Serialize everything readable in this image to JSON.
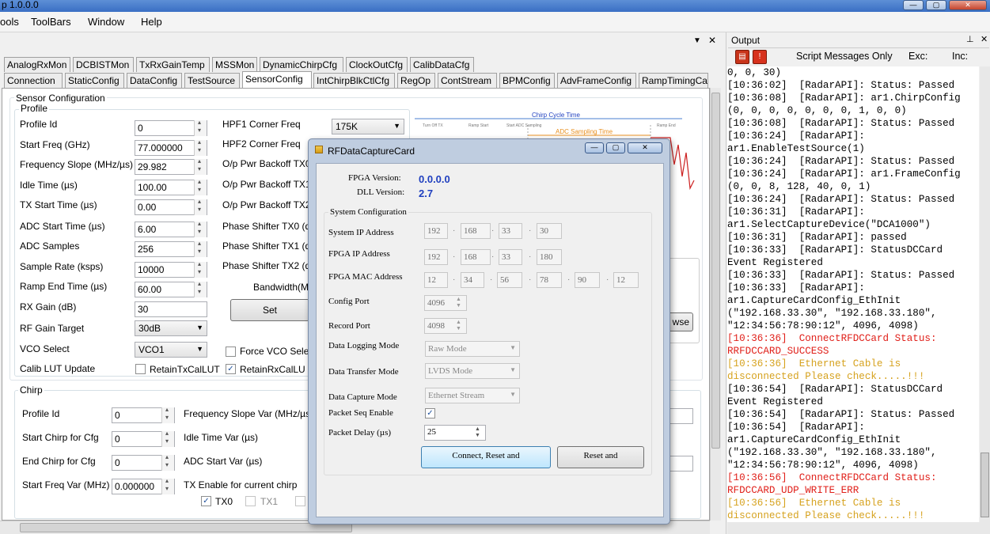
{
  "window": {
    "title": "p 1.0.0.0",
    "min": "—",
    "max": "▢",
    "close": "✕"
  },
  "menu": [
    "ools",
    "ToolBars",
    "Window",
    "Help"
  ],
  "tabs_row1": [
    "AnalogRxMon",
    "DCBISTMon",
    "TxRxGainTemp",
    "MSSMon",
    "DynamicChirpCfg",
    "ClockOutCfg",
    "CalibDataCfg"
  ],
  "tabs_row2": [
    "Connection",
    "StaticConfig",
    "DataConfig",
    "TestSource",
    "SensorConfig",
    "IntChirpBlkCtlCfg",
    "RegOp",
    "ContStream",
    "BPMConfig",
    "AdvFrameConfig",
    "RampTimingCa"
  ],
  "sensor": {
    "group": "Sensor Configuration",
    "profile_group": "Profile",
    "fields": [
      {
        "label": "Profile Id",
        "value": "0"
      },
      {
        "label": "Start Freq (GHz)",
        "value": "77.000000"
      },
      {
        "label": "Frequency Slope (MHz/µs)",
        "value": "29.982"
      },
      {
        "label": "Idle Time (µs)",
        "value": "100.00"
      },
      {
        "label": "TX Start Time (µs)",
        "value": "0.00"
      },
      {
        "label": "ADC Start Time (µs)",
        "value": "6.00"
      },
      {
        "label": "ADC Samples",
        "value": "256"
      },
      {
        "label": "Sample Rate (ksps)",
        "value": "10000"
      },
      {
        "label": "Ramp End Time (µs)",
        "value": "60.00"
      },
      {
        "label": "RX Gain (dB)",
        "value": "30"
      }
    ],
    "rf_gain_label": "RF Gain Target",
    "rf_gain_value": "30dB",
    "vco_label": "VCO Select",
    "vco_value": "VCO1",
    "calib_label": "Calib LUT Update",
    "retain_tx": "RetainTxCalLUT",
    "retain_rx": "RetainRxCalLU",
    "right_labels": [
      "HPF1 Corner Freq",
      "HPF2 Corner Freq",
      "O/p Pwr Backoff TX0",
      "O/p Pwr Backoff TX1",
      "O/p Pwr Backoff TX2",
      "Phase Shifter TX0 (d",
      "Phase Shifter TX1 (d",
      "Phase Shifter TX2 (d"
    ],
    "hpf1_value": "175K",
    "bandwidth_label": "Bandwidth(M",
    "set_button": "Set",
    "force_vco": "Force VCO Sele",
    "browse": "wse",
    "diagram": {
      "chirp_cycle": "Chirp Cycle Time",
      "adc_sampling": "ADC Sampling Time",
      "turn_off": "Turn Off TX",
      "ramp_start": "Ramp Start",
      "start_adc": "Start ADC Sampling",
      "ramp_end": "Ramp End"
    }
  },
  "chirp": {
    "group": "Chirp",
    "fields": [
      {
        "label": "Profile Id",
        "value": "0"
      },
      {
        "label": "Start Chirp for Cfg",
        "value": "0"
      },
      {
        "label": "End Chirp for Cfg",
        "value": "0"
      },
      {
        "label": "Start Freq Var (MHz)",
        "value": "0.000000"
      }
    ],
    "right_labels": [
      "Frequency Slope Var (MHz/µs",
      "Idle Time Var (µs)",
      "ADC Start Var (µs)",
      "TX Enable for current chirp"
    ],
    "tx0": "TX0",
    "tx1": "TX1"
  },
  "dialog": {
    "title": "RFDataCaptureCard",
    "fpga_version_label": "FPGA Version:",
    "fpga_version": "0.0.0.0",
    "dll_version_label": "DLL Version:",
    "dll_version": "2.7",
    "sys_config": "System Configuration",
    "system_ip_label": "System IP Address",
    "system_ip": [
      "192",
      "168",
      "33",
      "30"
    ],
    "fpga_ip_label": "FPGA IP Address",
    "fpga_ip": [
      "192",
      "168",
      "33",
      "180"
    ],
    "fpga_mac_label": "FPGA MAC Address",
    "fpga_mac": [
      "12",
      "34",
      "56",
      "78",
      "90",
      "12"
    ],
    "config_port_label": "Config Port",
    "config_port": "4096",
    "record_port_label": "Record Port",
    "record_port": "4098",
    "logging_label": "Data Logging Mode",
    "logging": "Raw Mode",
    "transfer_label": "Data Transfer Mode",
    "transfer": "LVDS Mode",
    "capture_label": "Data Capture Mode",
    "capture": "Ethernet Stream",
    "pkt_seq_label": "Packet Seq Enable",
    "pkt_delay_label": "Packet Delay (µs)",
    "pkt_delay": "25",
    "connect_btn": "Connect, Reset and",
    "reset_btn": "Reset and"
  },
  "output": {
    "title": "Output",
    "filter": "Script Messages Only",
    "exc": "Exc:",
    "inc": "Inc:",
    "lines": [
      {
        "t": "0, 0, 30)",
        "c": "#000"
      },
      {
        "t": "[10:36:02]  [RadarAPI]: Status: Passed",
        "c": "#000"
      },
      {
        "t": "[10:36:08]  [RadarAPI]: ar1.ChirpConfig",
        "c": "#000"
      },
      {
        "t": "(0, 0, 0, 0, 0, 0, 0, 1, 0, 0)",
        "c": "#000"
      },
      {
        "t": "[10:36:08]  [RadarAPI]: Status: Passed",
        "c": "#000"
      },
      {
        "t": "[10:36:24]  [RadarAPI]:",
        "c": "#000"
      },
      {
        "t": "ar1.EnableTestSource(1)",
        "c": "#000"
      },
      {
        "t": "[10:36:24]  [RadarAPI]: Status: Passed",
        "c": "#000"
      },
      {
        "t": "[10:36:24]  [RadarAPI]: ar1.FrameConfig",
        "c": "#000"
      },
      {
        "t": "(0, 0, 8, 128, 40, 0, 1)",
        "c": "#000"
      },
      {
        "t": "[10:36:24]  [RadarAPI]: Status: Passed",
        "c": "#000"
      },
      {
        "t": "[10:36:31]  [RadarAPI]:",
        "c": "#000"
      },
      {
        "t": "ar1.SelectCaptureDevice(\"DCA1000\")",
        "c": "#000"
      },
      {
        "t": "[10:36:31]  [RadarAPI]: passed",
        "c": "#000"
      },
      {
        "t": "[10:36:33]  [RadarAPI]: StatusDCCard",
        "c": "#000"
      },
      {
        "t": "Event Registered",
        "c": "#000"
      },
      {
        "t": "[10:36:33]  [RadarAPI]: Status: Passed",
        "c": "#000"
      },
      {
        "t": "[10:36:33]  [RadarAPI]:",
        "c": "#000"
      },
      {
        "t": "ar1.CaptureCardConfig_EthInit",
        "c": "#000"
      },
      {
        "t": "(\"192.168.33.30\", \"192.168.33.180\",",
        "c": "#000"
      },
      {
        "t": "\"12:34:56:78:90:12\", 4096, 4098)",
        "c": "#000"
      },
      {
        "t": "[10:36:36]  ConnectRFDCCard Status:",
        "c": "#e0201a"
      },
      {
        "t": "RRFDCCARD_SUCCESS",
        "c": "#e0201a"
      },
      {
        "t": "[10:36:36]  Ethernet Cable is",
        "c": "#d6a21e"
      },
      {
        "t": "disconnected Please check.....!!!",
        "c": "#d6a21e"
      },
      {
        "t": "[10:36:54]  [RadarAPI]: StatusDCCard",
        "c": "#000"
      },
      {
        "t": "Event Registered",
        "c": "#000"
      },
      {
        "t": "[10:36:54]  [RadarAPI]: Status: Passed",
        "c": "#000"
      },
      {
        "t": "[10:36:54]  [RadarAPI]:",
        "c": "#000"
      },
      {
        "t": "ar1.CaptureCardConfig_EthInit",
        "c": "#000"
      },
      {
        "t": "(\"192.168.33.30\", \"192.168.33.180\",",
        "c": "#000"
      },
      {
        "t": "\"12:34:56:78:90:12\", 4096, 4098)",
        "c": "#000"
      },
      {
        "t": "[10:36:56]  ConnectRFDCCard Status:",
        "c": "#e0201a"
      },
      {
        "t": "RFDCCARD_UDP_WRITE_ERR",
        "c": "#e0201a"
      },
      {
        "t": "[10:36:56]  Ethernet Cable is",
        "c": "#d6a21e"
      },
      {
        "t": "disconnected Please check.....!!!",
        "c": "#d6a21e"
      }
    ]
  },
  "colors": {
    "accent": "#1f3fbf",
    "error": "#e0201a",
    "warning": "#d6a21e"
  }
}
